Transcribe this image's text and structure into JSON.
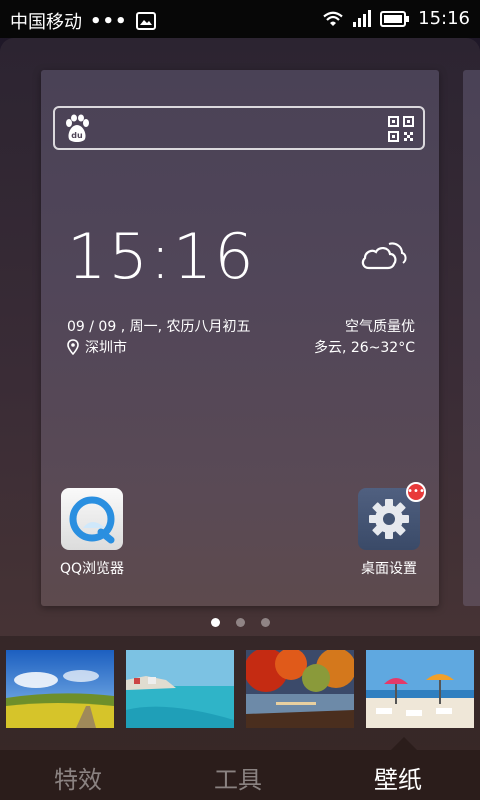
{
  "status_bar": {
    "carrier": "中国移动",
    "dots": "•••",
    "time": "15:16"
  },
  "widget": {
    "clock": "15:16",
    "date": "09 / 09 , 周一, 农历八月初五",
    "location": "深圳市",
    "air_quality": "空气质量优",
    "weather": "多云, 26~32°C"
  },
  "apps": [
    {
      "label": "QQ浏览器"
    },
    {
      "label": "桌面设置",
      "badge": "•••"
    }
  ],
  "pager": {
    "count": 3,
    "active": 0
  },
  "tabs": [
    {
      "label": "特效",
      "active": false
    },
    {
      "label": "工具",
      "active": false
    },
    {
      "label": "壁纸",
      "active": true
    }
  ],
  "colors": {
    "badge": "#e83a3a",
    "tab_bar": "#2b1d1b"
  }
}
